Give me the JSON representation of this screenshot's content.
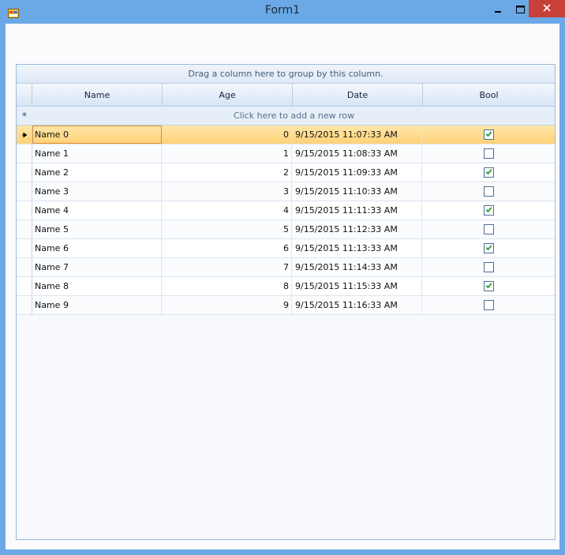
{
  "window": {
    "title": "Form1",
    "buttons": {
      "minimize": "minimize-icon",
      "maximize": "maximize-icon",
      "close": "close-icon"
    },
    "colors": {
      "frame": "#6aa9e6",
      "close": "#c7403a"
    }
  },
  "grid": {
    "group_panel_text": "Drag a column here to group by this column.",
    "columns": [
      "Name",
      "Age",
      "Date",
      "Bool"
    ],
    "new_row_text": "Click here to add a new row",
    "new_row_indicator": "*",
    "current_row_indicator": "arrow-right-icon",
    "rows": [
      {
        "name": "Name 0",
        "age": "0",
        "date": "9/15/2015 11:07:33 AM",
        "bool": true
      },
      {
        "name": "Name 1",
        "age": "1",
        "date": "9/15/2015 11:08:33 AM",
        "bool": false
      },
      {
        "name": "Name 2",
        "age": "2",
        "date": "9/15/2015 11:09:33 AM",
        "bool": true
      },
      {
        "name": "Name 3",
        "age": "3",
        "date": "9/15/2015 11:10:33 AM",
        "bool": false
      },
      {
        "name": "Name 4",
        "age": "4",
        "date": "9/15/2015 11:11:33 AM",
        "bool": true
      },
      {
        "name": "Name 5",
        "age": "5",
        "date": "9/15/2015 11:12:33 AM",
        "bool": false
      },
      {
        "name": "Name 6",
        "age": "6",
        "date": "9/15/2015 11:13:33 AM",
        "bool": true
      },
      {
        "name": "Name 7",
        "age": "7",
        "date": "9/15/2015 11:14:33 AM",
        "bool": false
      },
      {
        "name": "Name 8",
        "age": "8",
        "date": "9/15/2015 11:15:33 AM",
        "bool": true
      },
      {
        "name": "Name 9",
        "age": "9",
        "date": "9/15/2015 11:16:33 AM",
        "bool": false
      }
    ],
    "selected_index": 0,
    "colors": {
      "selected_row": "#ffd177",
      "selected_cell_border": "#e68a2a",
      "check": "#2e9a3a"
    }
  }
}
